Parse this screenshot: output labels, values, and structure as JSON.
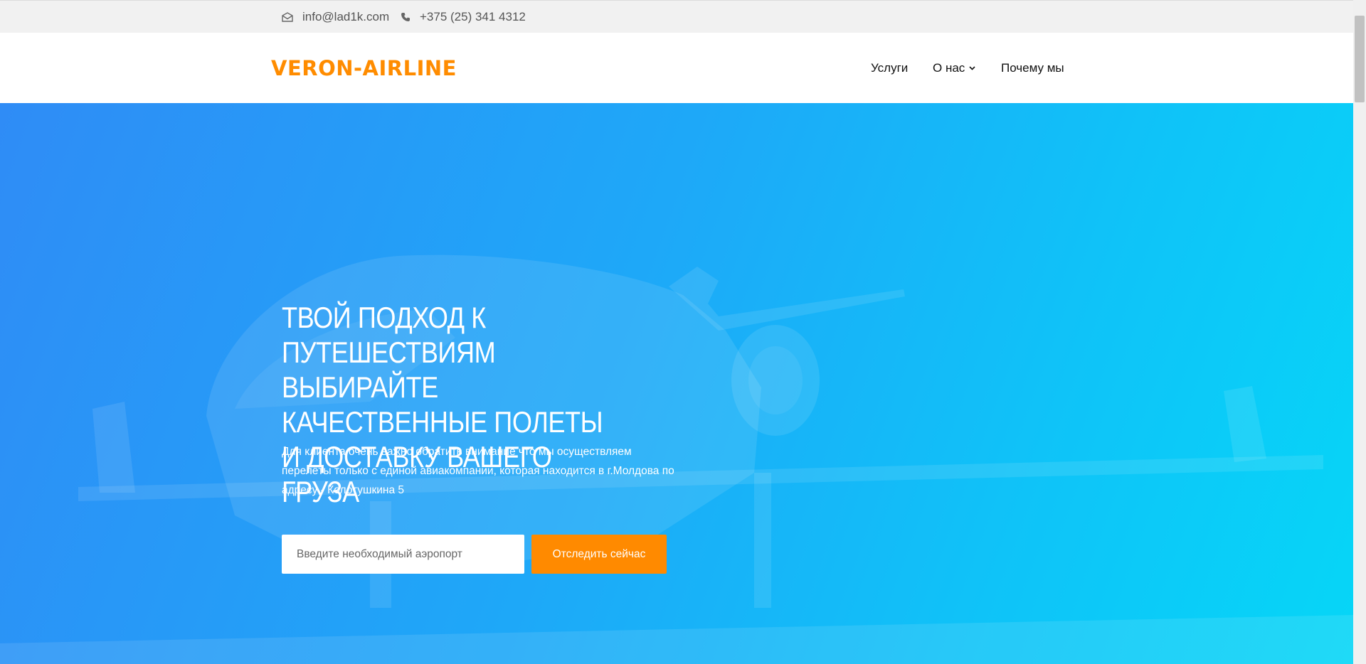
{
  "topbar": {
    "email": "info@lad1k.com",
    "phone": "+375 (25) 341 4312",
    "email_icon": "envelope-icon",
    "phone_icon": "phone-icon"
  },
  "header": {
    "logo": "VERON-AIRLINE",
    "nav": [
      {
        "label": "Услуги"
      },
      {
        "label": "О нас",
        "icon": "chevron-down-icon"
      },
      {
        "label": "Почему мы"
      }
    ]
  },
  "hero": {
    "headline": "ТВОЙ ПОДХОД К ПУТЕШЕСТВИЯМ ВЫБИРАЙТЕ КАЧЕСТВЕННЫЕ ПОЛЕТЫ И ДОСТАВКУ ВАШЕГО ГРУЗА",
    "description": "Для клиента очень важно обратить внимание что мы осуществляем перелёты только с единой авиакомпании, которая находится в г.Молдова по адресу - Колотушкина 5",
    "search": {
      "placeholder": "Введите необходимый аэропорт",
      "value": ""
    },
    "button_label": "Отследить сейчас"
  },
  "colors": {
    "accent": "#ff8c00",
    "hero_gradient_start": "#2f8cf6",
    "hero_gradient_end": "#06d6f7",
    "topbar_bg": "#f1f1f1"
  }
}
